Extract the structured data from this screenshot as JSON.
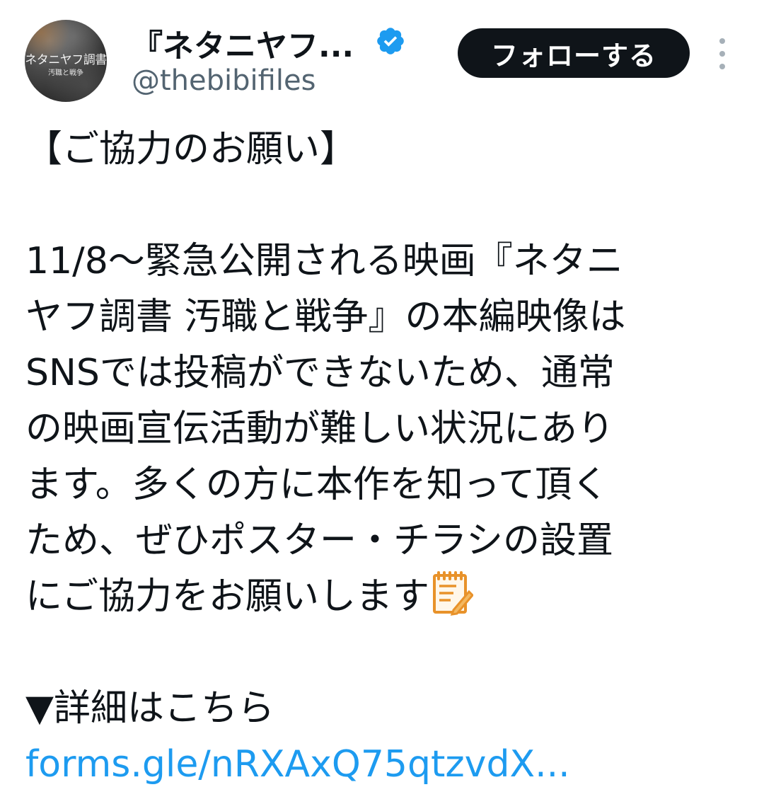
{
  "header": {
    "avatar_title": "ネタニヤフ調書",
    "avatar_subtitle": "汚職と戦争",
    "display_name": "『ネタニヤフ...",
    "handle": "@thebibifiles",
    "follow_label": "フォローする",
    "verified_icon": "verified-badge-icon",
    "verified_color": "#1d9bf0"
  },
  "tweet": {
    "heading": "【ご協力のお願い】",
    "paragraph_lines": [
      "11/8～緊急公開される映画『ネタニ",
      "ヤフ調書 汚職と戦争』の本編映像は",
      "SNSでは投稿ができないため、通常",
      "の映画宣伝活動が難しい状況にあり",
      "ます。多くの方に本作を知って頂く",
      "ため、ぜひポスター・チラシの設置",
      "にご協力をお願いします"
    ],
    "memo_icon": "memo-icon",
    "details_label": "▼詳細はこちら",
    "link_text": "forms.gle/nRXAxQ75qtzvdX..."
  },
  "colors": {
    "text": "#0f1419",
    "secondary": "#536471",
    "link": "#1d9bf0",
    "button_bg": "#0f1419",
    "button_text": "#ffffff"
  }
}
